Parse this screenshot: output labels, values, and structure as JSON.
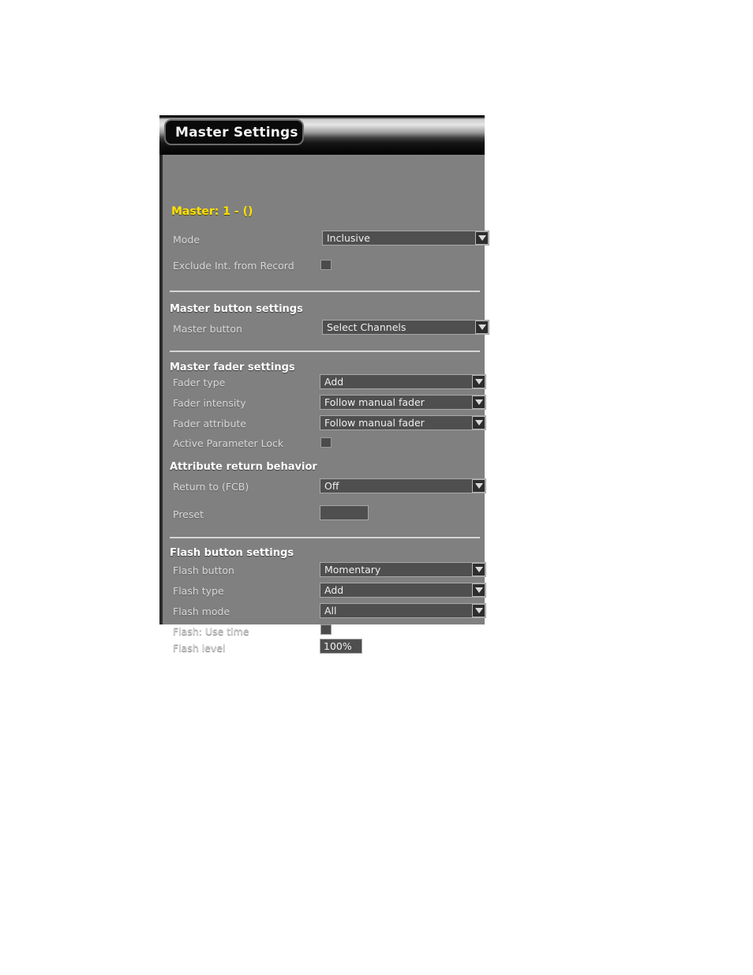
{
  "window": {
    "title": "Master Settings"
  },
  "master_header": "Master: 1 - ()",
  "sections": {
    "general": {
      "rows": [
        {
          "label": "Mode",
          "value": "Inclusive",
          "control": "dropdown"
        },
        {
          "label": "Exclude Int. from Record",
          "value": "",
          "control": "checkbox"
        }
      ]
    },
    "master_button": {
      "heading": "Master button settings",
      "rows": [
        {
          "label": "Master button",
          "value": "Select Channels",
          "control": "dropdown"
        }
      ]
    },
    "master_fader": {
      "heading": "Master fader settings",
      "rows": [
        {
          "label": "Fader type",
          "value": "Add",
          "control": "dropdown"
        },
        {
          "label": "Fader intensity",
          "value": "Follow manual fader",
          "control": "dropdown"
        },
        {
          "label": "Fader attribute",
          "value": "Follow manual fader",
          "control": "dropdown"
        },
        {
          "label": "Active Parameter Lock",
          "value": "",
          "control": "checkbox"
        }
      ]
    },
    "attribute_return": {
      "heading": "Attribute return behavior",
      "rows": [
        {
          "label": "Return to (FCB)",
          "value": "Off",
          "control": "dropdown"
        },
        {
          "label": "Preset",
          "value": "",
          "control": "textbox"
        }
      ]
    },
    "flash_button": {
      "heading": "Flash button settings",
      "rows": [
        {
          "label": "Flash button",
          "value": "Momentary",
          "control": "dropdown"
        },
        {
          "label": "Flash type",
          "value": "Add",
          "control": "dropdown"
        },
        {
          "label": "Flash mode",
          "value": "All",
          "control": "dropdown"
        },
        {
          "label": "Flash: Use time",
          "value": "",
          "control": "checkbox"
        },
        {
          "label": "Flash level",
          "value": "100%",
          "control": "textbox"
        }
      ]
    }
  },
  "colors": {
    "panel_bg": "#808080",
    "accent_yellow": "#ffe000",
    "control_bg": "#4f4f4f",
    "control_border": "#a8a8a8",
    "divider": "#d5d5d5",
    "heading_text": "#ffffff",
    "label_text": "#d8d8d8"
  }
}
